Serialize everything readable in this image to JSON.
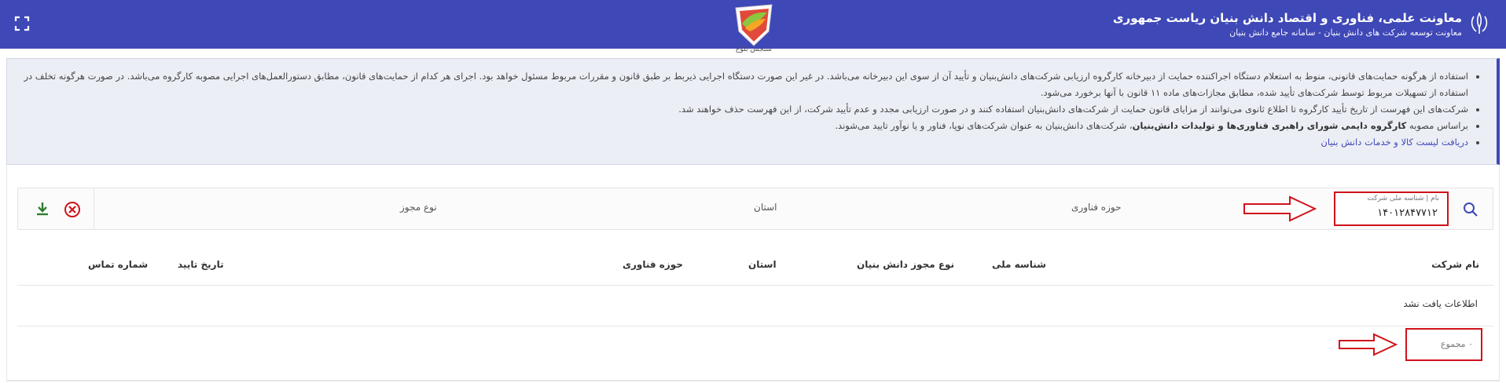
{
  "header": {
    "title": "معاونت علمی، فناوری و اقتصاد دانش بنیان ریاست جمهوری",
    "subtitle": "معاونت توسعه شرکت های دانش بنیان - سامانه جامع دانش بنیان",
    "logo_caption": "سنجش بلوغ",
    "bg_color": "#3f48b7"
  },
  "notice": {
    "items": [
      "استفاده از هرگونه حمایت‌های قانونی، منوط به استعلام دستگاه اجراکننده حمایت از دبیرخانه کارگروه ارزیابی شرکت‌های دانش‌بنیان و تأیید آن از سوی این دبیرخانه می‌باشد. در غیر این صورت دستگاه اجرایی ذیربط بر طبق قانون و مقررات مربوط مسئول خواهد بود. اجرای هر کدام از حمایت‌های قانون، مطابق دستورالعمل‌های اجرایی مصوبه کارگروه می‌باشد. در صورت هرگونه تخلف در استفاده از تسهیلات مربوط توسط شرکت‌های تأیید شده، مطابق مجازات‌های ماده ۱۱ قانون با آنها برخورد می‌شود.",
      "شرکت‌های این فهرست از تاریخ تأیید کارگروه تا اطلاع ثانوی می‌توانند از مزایای قانون حمایت از شرکت‌های دانش‌بنیان استفاده کنند و در صورت ارزیابی مجدد و عدم تأیید شرکت، از این فهرست حذف خواهند شد."
    ],
    "item3_prefix": "براساس مصوبه ",
    "item3_bold": "کارگروه دایمی شورای راهبری فناوری‌ها و تولیدات دانش‌بنیان",
    "item3_suffix": "، شرکت‌های دانش‌بنیان به عنوان شرکت‌های نوپا، فناور و یا نوآور تایید می‌شوند.",
    "link_label": "دریافت لیست کالا و خدمات دانش بنیان"
  },
  "filters": {
    "search_label": "نام | شناسه ملی شرکت",
    "search_value": "۱۴۰۱۲۸۴۷۷۱۲",
    "tech_area": "حوزه فناوری",
    "province": "استان",
    "license_type": "نوع مجوز"
  },
  "table": {
    "columns": [
      "نام شرکت",
      "شناسه ملی",
      "نوع مجوز دانش بنیان",
      "استان",
      "حوزه فناوری",
      "تاریخ تایید",
      "شماره تماس"
    ],
    "empty_message": "اطلاعات یافت نشد",
    "total_label": "۰ مجموع"
  },
  "colors": {
    "accent": "#3f48b7",
    "annotation": "#d0121b"
  }
}
